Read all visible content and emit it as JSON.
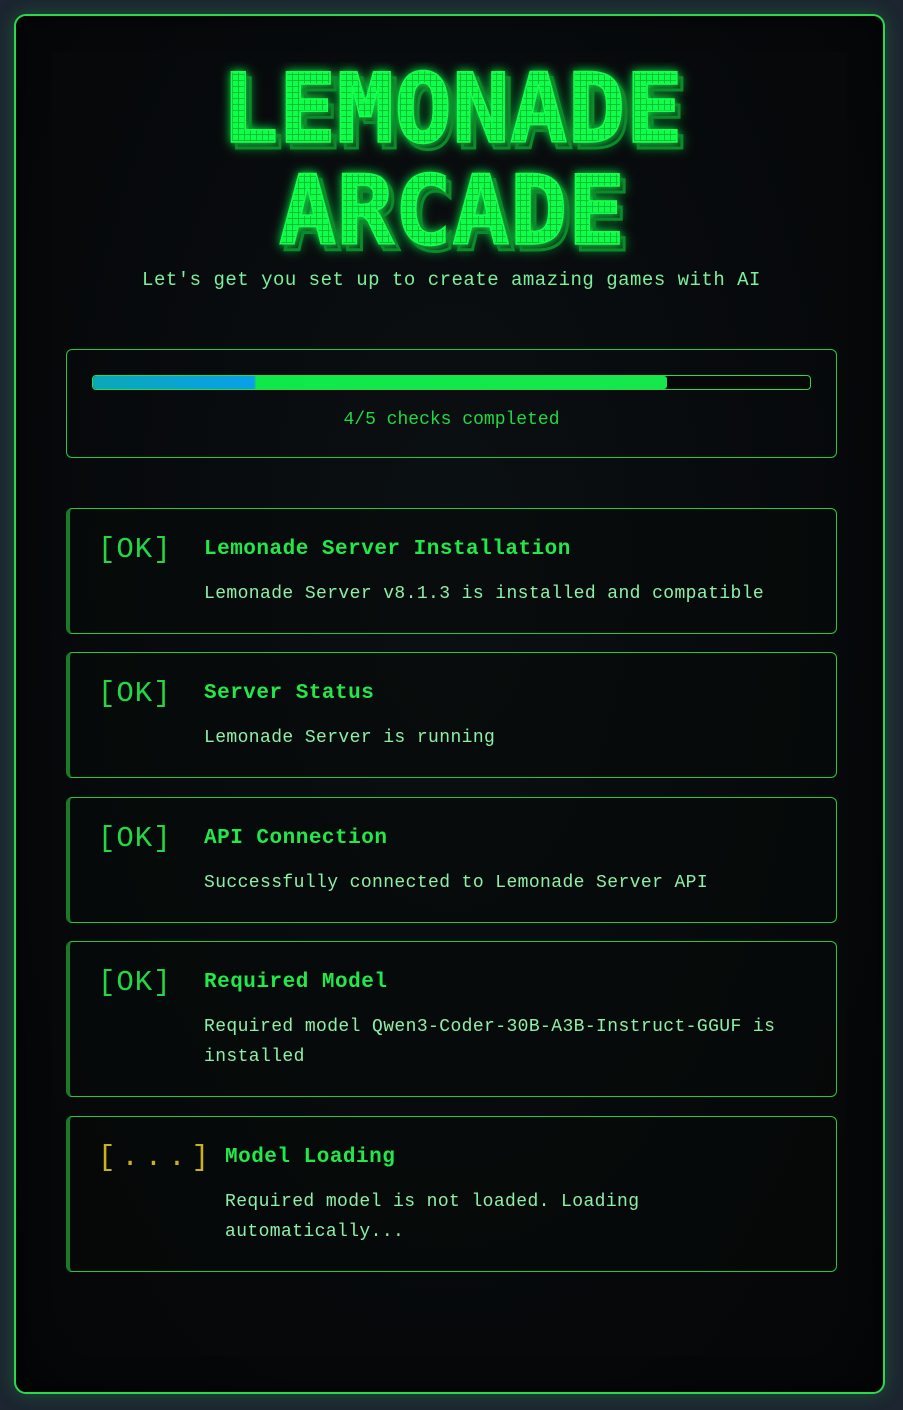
{
  "app": {
    "title_line1": "LEMONADE",
    "title_line2": "ARCADE",
    "subtitle": "Let's get you set up to create amazing games with AI"
  },
  "progress": {
    "completed": 4,
    "total": 5,
    "fraction": 0.8,
    "label": "4/5 checks completed"
  },
  "checks": [
    {
      "status": "[OK]",
      "state": "ok",
      "name": "Lemonade Server Installation",
      "description": "Lemonade Server v8.1.3 is installed and compatible"
    },
    {
      "status": "[OK]",
      "state": "ok",
      "name": "Server Status",
      "description": "Lemonade Server is running"
    },
    {
      "status": "[OK]",
      "state": "ok",
      "name": "API Connection",
      "description": "Successfully connected to Lemonade Server API"
    },
    {
      "status": "[OK]",
      "state": "ok",
      "name": "Required Model",
      "description": "Required model Qwen3-Coder-30B-A3B-Instruct-GGUF is installed"
    },
    {
      "status": "[...]",
      "state": "pending",
      "name": "Model Loading",
      "description": "Required model is not loaded. Loading automatically..."
    }
  ],
  "colors": {
    "accent": "#22e84a",
    "border": "#2bd94a",
    "pending": "#c9b21a",
    "progress_start": "#0aa9e8",
    "background": "#06080a"
  }
}
